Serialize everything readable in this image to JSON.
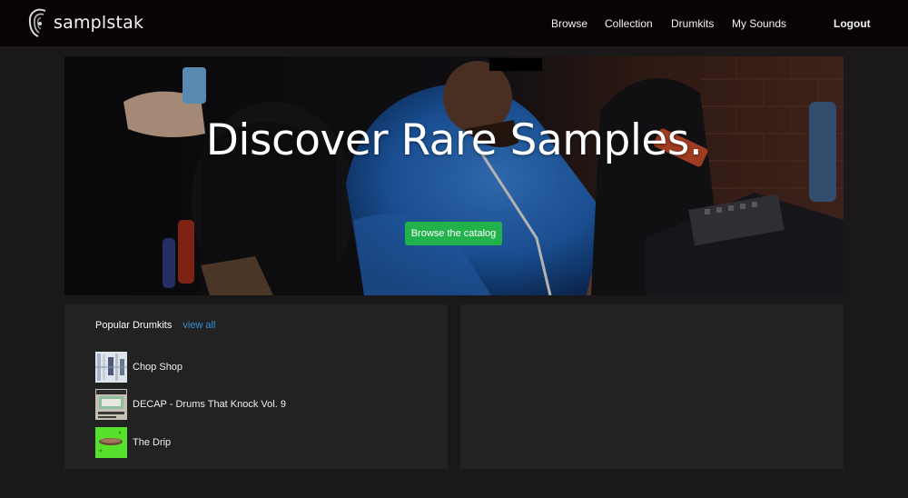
{
  "brand": {
    "name": "samplstak"
  },
  "nav": {
    "browse": "Browse",
    "collection": "Collection",
    "drumkits": "Drumkits",
    "my_sounds": "My Sounds",
    "logout": "Logout"
  },
  "hero": {
    "title": "Discover Rare Samples.",
    "button": "Browse the catalog"
  },
  "popular": {
    "title": "Popular Drumkits",
    "view_all": "view all",
    "items": [
      {
        "name": "Chop Shop"
      },
      {
        "name": "DECAP - Drums That Knock Vol. 9"
      },
      {
        "name": "The Drip"
      }
    ]
  },
  "colors": {
    "accent_green": "#22b24c",
    "link_blue": "#2e8fd8",
    "navbar_bg": "#080405",
    "page_bg": "#1b1819",
    "panel_bg": "#232223"
  }
}
